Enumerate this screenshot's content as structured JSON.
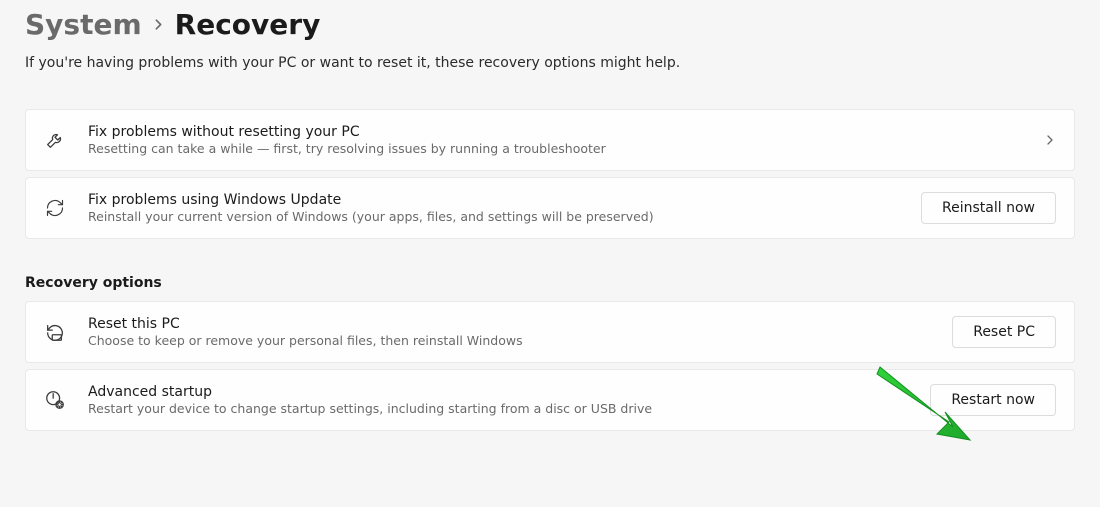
{
  "breadcrumb": {
    "parent": "System",
    "current": "Recovery"
  },
  "description": "If you're having problems with your PC or want to reset it, these recovery options might help.",
  "topCards": [
    {
      "title": "Fix problems without resetting your PC",
      "sub": "Resetting can take a while — first, try resolving issues by running a troubleshooter",
      "action": "chevron"
    },
    {
      "title": "Fix problems using Windows Update",
      "sub": "Reinstall your current version of Windows (your apps, files, and settings will be preserved)",
      "action": "button",
      "button": "Reinstall now"
    }
  ],
  "sectionTitle": "Recovery options",
  "recoveryCards": [
    {
      "title": "Reset this PC",
      "sub": "Choose to keep or remove your personal files, then reinstall Windows",
      "button": "Reset PC"
    },
    {
      "title": "Advanced startup",
      "sub": "Restart your device to change startup settings, including starting from a disc or USB drive",
      "button": "Restart now"
    }
  ]
}
